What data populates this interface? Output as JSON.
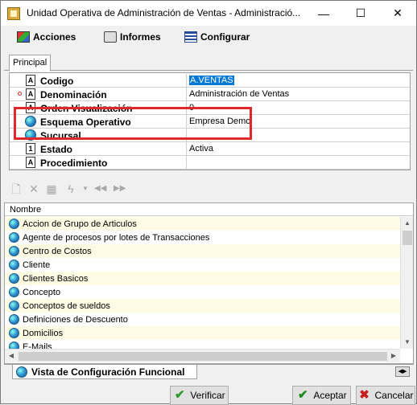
{
  "window": {
    "title": "Unidad Operativa de Administración de Ventas - Administració...",
    "minimize_glyph": "—",
    "maximize_glyph": "☐",
    "close_glyph": "✕"
  },
  "menu": {
    "acciones": "Acciones",
    "informes": "Informes",
    "configurar": "Configurar"
  },
  "tabs": {
    "principal": "Principal"
  },
  "properties": [
    {
      "name": "Codigo",
      "value": "A.VENTAS",
      "icon": "doc-icon",
      "required": false,
      "selected": true
    },
    {
      "name": "Denominación",
      "value": "Administración de Ventas",
      "icon": "doc-icon",
      "required": true,
      "selected": false
    },
    {
      "name": "Orden Visualización",
      "value": "0",
      "icon": "doc-icon",
      "required": false,
      "selected": false
    },
    {
      "name": "Esquema Operativo",
      "value": "Empresa Demo",
      "icon": "globe-icon",
      "required": false,
      "selected": false
    },
    {
      "name": "Sucursal",
      "value": "",
      "icon": "globe-icon",
      "required": false,
      "selected": false
    },
    {
      "name": "Estado",
      "value": "Activa",
      "icon": "num-icon",
      "required": false,
      "selected": false
    },
    {
      "name": "Procedimiento",
      "value": "",
      "icon": "doc-icon",
      "required": false,
      "selected": false
    }
  ],
  "list": {
    "header": "Nombre",
    "items": [
      "Accion de Grupo de Articulos",
      "Agente de procesos por lotes de Transacciones",
      "Centro de Costos",
      "Cliente",
      "Clientes Basicos",
      "Concepto",
      "Conceptos de sueldos",
      "Definiciones de Descuento",
      "Domicilios",
      "E-Mails"
    ]
  },
  "bottom_tab": {
    "label": "Vista de Configuración Funcional"
  },
  "buttons": {
    "verificar": "Verificar",
    "aceptar": "Aceptar",
    "cancelar": "Cancelar"
  },
  "colors": {
    "highlight_box": "#e0282a",
    "selection": "#0078d7",
    "alt_row": "#fdfbe3"
  }
}
